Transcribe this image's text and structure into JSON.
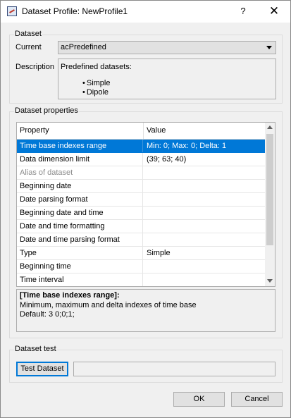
{
  "window": {
    "title": "Dataset Profile: NewProfile1",
    "help_label": "?",
    "close_label": "✕"
  },
  "dataset_group": {
    "label": "Dataset",
    "current_label": "Current",
    "current_value": "acPredefined",
    "description_label": "Description",
    "description_text": "Predefined datasets:",
    "description_items": [
      "Simple",
      "Dipole"
    ]
  },
  "properties_group": {
    "label": "Dataset properties",
    "columns": [
      "Property",
      "Value"
    ],
    "rows": [
      {
        "property": "Time base indexes range",
        "value": "Min: 0; Max: 0; Delta: 1",
        "selected": true
      },
      {
        "property": "Data dimension limit",
        "value": "(39; 63; 40)"
      },
      {
        "property": "Alias of dataset",
        "value": "",
        "disabled": true
      },
      {
        "property": "Beginning date",
        "value": ""
      },
      {
        "property": "Date parsing format",
        "value": ""
      },
      {
        "property": "Beginning date and time",
        "value": ""
      },
      {
        "property": "Date and time formatting",
        "value": ""
      },
      {
        "property": "Date and time parsing format",
        "value": ""
      },
      {
        "property": "Type",
        "value": "Simple"
      },
      {
        "property": "Beginning time",
        "value": ""
      },
      {
        "property": "Time interval",
        "value": ""
      }
    ],
    "help_title": "[Time base indexes range]:",
    "help_line1": "Minimum, maximum and delta indexes of time base",
    "help_line2": "Default: 3 0;0;1;"
  },
  "test_group": {
    "label": "Dataset test",
    "test_button": "Test Dataset",
    "result_value": ""
  },
  "footer": {
    "ok_label": "OK",
    "cancel_label": "Cancel"
  },
  "colors": {
    "selection": "#0078d7",
    "dialog_bg": "#f0f0f0"
  }
}
